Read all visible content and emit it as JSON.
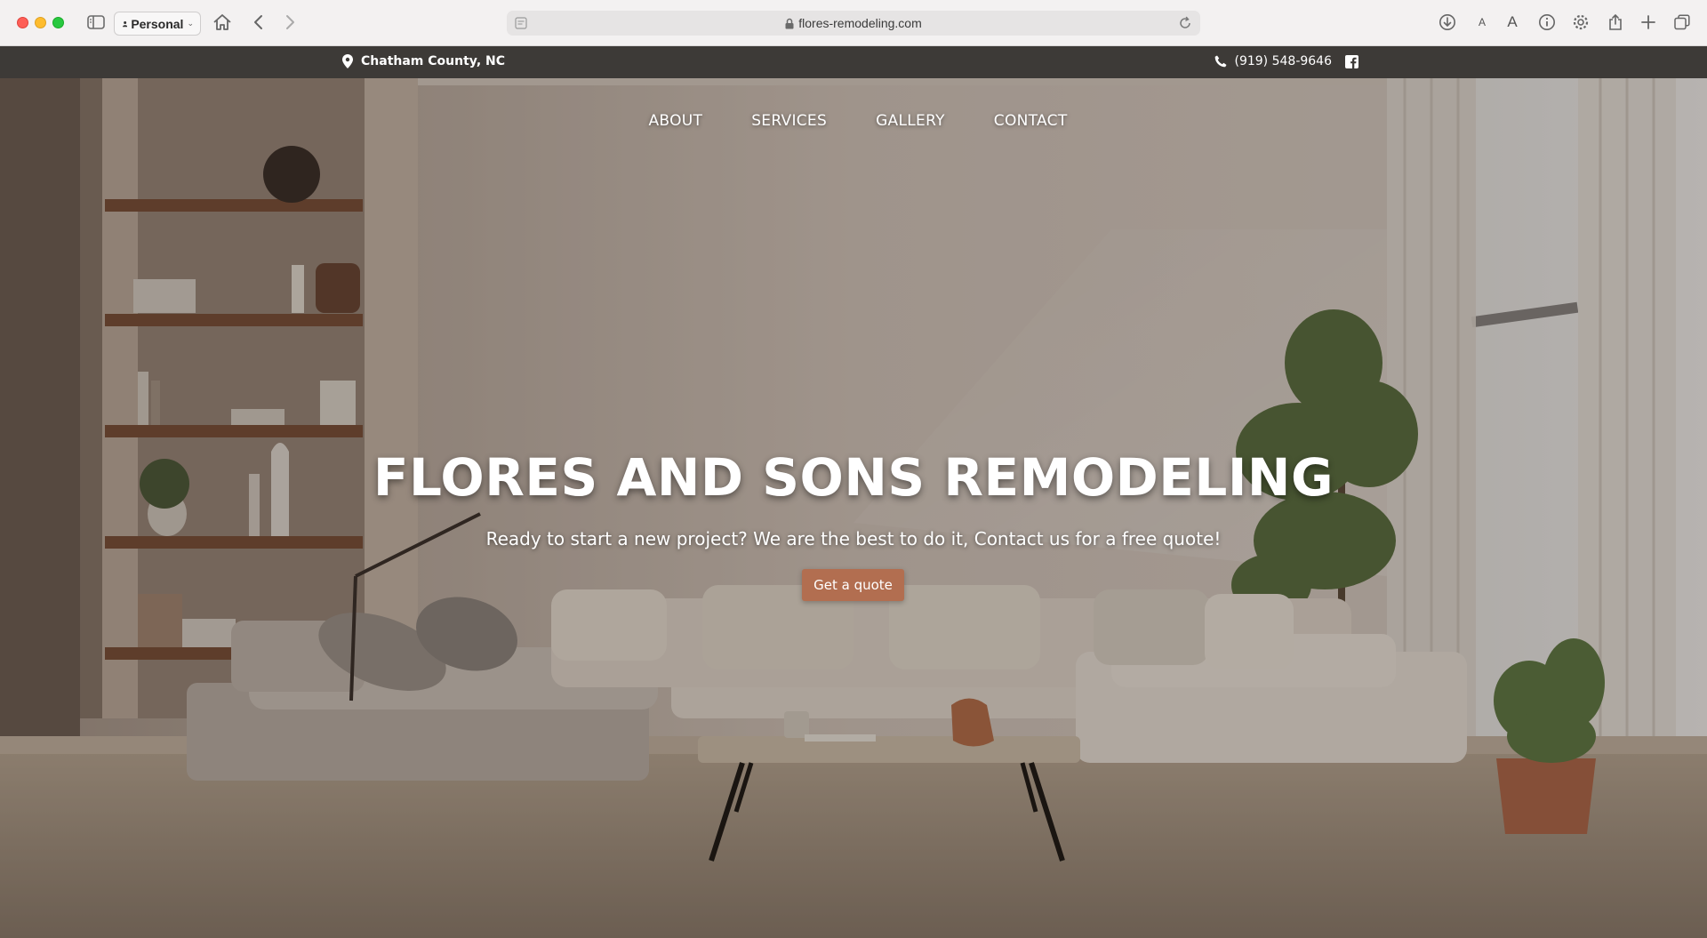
{
  "browser": {
    "profile": "Personal",
    "url": "flores-remodeling.com",
    "text_size_small": "A",
    "text_size_large": "A"
  },
  "topbar": {
    "location": "Chatham County, NC",
    "phone": "(919) 548-9646",
    "social": "facebook"
  },
  "nav": {
    "items": [
      "ABOUT",
      "SERVICES",
      "GALLERY",
      "CONTACT"
    ]
  },
  "hero": {
    "title": "FLORES AND SONS REMODELING",
    "subtitle": "Ready to start a new project? We are the best to do it, Contact us for a free quote!",
    "cta": "Get a quote"
  },
  "colors": {
    "cta": "#b26e50",
    "infobar": "#3d3a37"
  }
}
